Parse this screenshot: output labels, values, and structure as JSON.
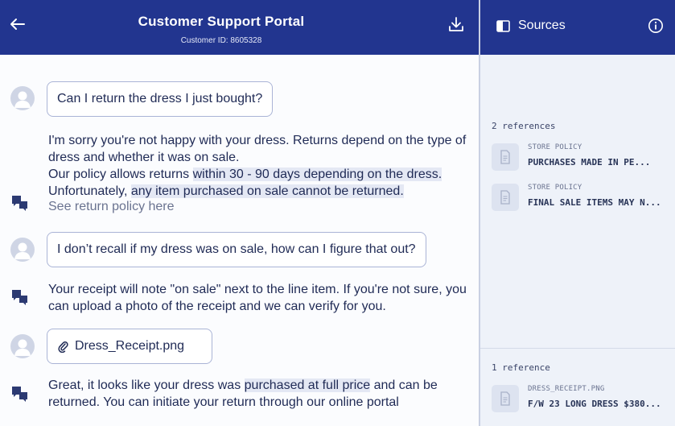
{
  "header": {
    "title": "Customer Support Portal",
    "customer_id_label": "Customer ID:",
    "customer_id": "8605328"
  },
  "sources": {
    "title": "Sources",
    "group1": {
      "count_label": "2 references",
      "items": [
        {
          "label": "STORE POLICY",
          "title": "PURCHASES MADE IN PE..."
        },
        {
          "label": "STORE POLICY",
          "title": "FINAL SALE ITEMS MAY N..."
        }
      ]
    },
    "group2": {
      "count_label": "1 reference",
      "items": [
        {
          "label": "DRESS_RECEIPT.PNG",
          "title": "F/W 23 LONG DRESS $380..."
        }
      ]
    }
  },
  "messages": {
    "q1": "Can I return the dress I just bought?",
    "a1": {
      "line1": "I'm sorry you're not happy with your dress. Returns depend on the type of dress and whether it was on sale.",
      "line2_pre": "Our policy allows returns ",
      "line2_hl": "within 30 - 90 days depending on the dress.",
      "line3_pre": "Unfortunately, ",
      "line3_hl": "any item purchased on sale cannot be returned.",
      "link": "See return policy here"
    },
    "q2": "I don’t recall if my dress was on sale, how can I figure that out?",
    "a2": "Your receipt will note \"on sale\" next to the line item. If you're not sure, you can upload a photo of the receipt and we can verify for you.",
    "q3_attachment": "Dress_Receipt.png",
    "a3": {
      "pre": "Great, it looks like your dress was ",
      "hl": "purchased at full price",
      "post": " and can be returned. You can initiate your return through our online portal"
    }
  },
  "icons": {
    "back": "arrow-left-icon",
    "download": "download-icon",
    "panel": "panel-icon",
    "info": "info-icon",
    "avatar": "user-avatar-icon",
    "bot": "chat-bot-icon",
    "document": "document-icon",
    "attachment": "paperclip-icon"
  },
  "colors": {
    "header_bg": "#22358f",
    "text": "#1f2a55",
    "highlight": "#e4e8f4",
    "sources_bg": "#eef2f9",
    "bubble_border": "#aab4d6"
  }
}
